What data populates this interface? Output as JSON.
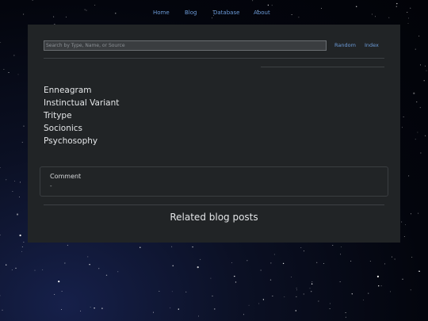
{
  "nav": {
    "items": [
      {
        "label": "Home"
      },
      {
        "label": "Blog"
      },
      {
        "label": "Database"
      },
      {
        "label": "About"
      }
    ]
  },
  "search": {
    "placeholder": "Search by Type, Name, or Source",
    "random_label": "Random",
    "index_label": "Index"
  },
  "systems": [
    {
      "label": "Enneagram"
    },
    {
      "label": "Instinctual Variant"
    },
    {
      "label": "Tritype"
    },
    {
      "label": "Socionics"
    },
    {
      "label": "Psychosophy"
    }
  ],
  "comment": {
    "label": "Comment",
    "value": "-"
  },
  "related": {
    "title": "Related blog posts"
  },
  "colors": {
    "link": "#6c9bd8",
    "panel": "#212426",
    "text": "#e4e6e8"
  }
}
